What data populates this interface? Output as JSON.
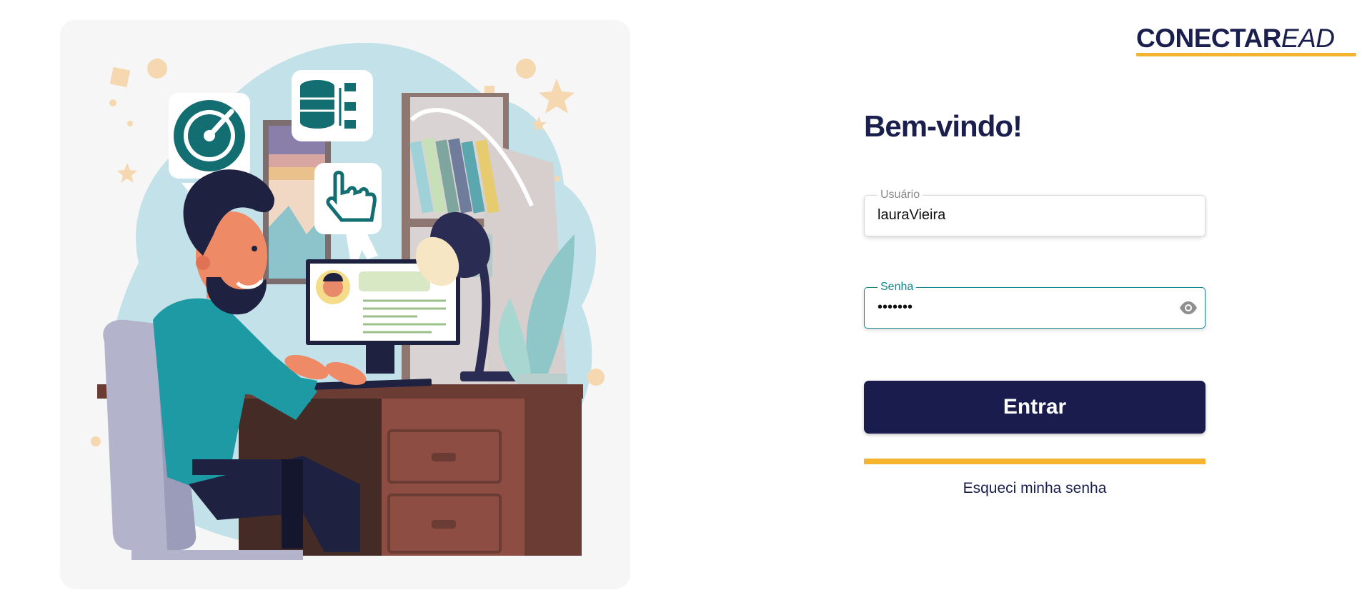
{
  "logo": {
    "bold_text": "CONECTAR",
    "light_text": "EAD"
  },
  "login": {
    "welcome": "Bem-vindo!",
    "username_label": "Usuário",
    "username_value": "lauraVieira",
    "password_label": "Senha",
    "password_value": "•••••••",
    "submit_label": "Entrar",
    "forgot_label": "Esqueci minha senha"
  },
  "colors": {
    "brand_navy": "#1a1c4d",
    "accent_yellow": "#f4b42e",
    "teal": "#17878c",
    "panel_bg": "#f6f6f6"
  },
  "icons": {
    "illustration": "person-at-desk-illustration",
    "gauge": "speedometer-icon",
    "database": "database-network-icon",
    "pointer": "hand-pointer-icon",
    "eye": "eye-icon"
  }
}
